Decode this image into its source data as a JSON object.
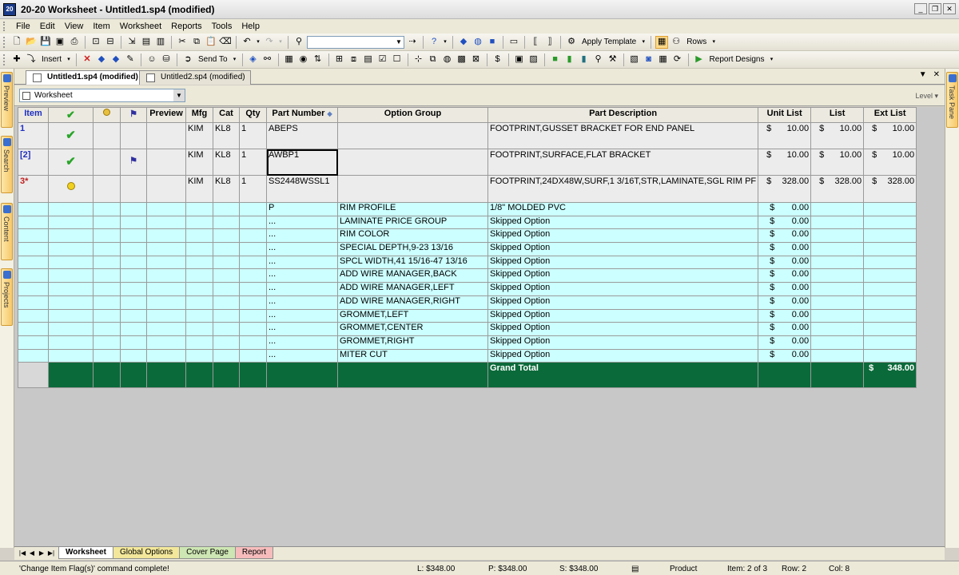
{
  "window": {
    "title": "20-20 Worksheet - Untitled1.sp4 (modified)",
    "icon_text": "20"
  },
  "menu": [
    "File",
    "Edit",
    "View",
    "Item",
    "Worksheet",
    "Reports",
    "Tools",
    "Help"
  ],
  "toolbar1": {
    "apply_template": "Apply Template",
    "rows": "Rows"
  },
  "toolbar2": {
    "insert": "Insert",
    "send_to": "Send To",
    "report_designs": "Report Designs"
  },
  "side_tabs_left": [
    "Preview",
    "Search",
    "Content",
    "Projects"
  ],
  "side_tabs_right": [
    "Task Pane"
  ],
  "doc_tabs": [
    {
      "label": "Untitled1.sp4 (modified)",
      "active": true
    },
    {
      "label": "Untitled2.sp4 (modified)",
      "active": false
    }
  ],
  "worksheet_selector": {
    "value": "Worksheet"
  },
  "level_label": "Level",
  "grid": {
    "headers": {
      "item": "Item",
      "preview": "Preview",
      "mfg": "Mfg",
      "cat": "Cat",
      "qty": "Qty",
      "part_number": "Part Number",
      "option_group": "Option Group",
      "part_description": "Part Description",
      "unit_list": "Unit List",
      "list": "List",
      "ext_list": "Ext List"
    },
    "currency": "$",
    "rows": [
      {
        "item": "1",
        "mfg": "KIM",
        "cat": "KL8",
        "qty": "1",
        "part_number": "ABEPS",
        "description": "FOOTPRINT,GUSSET BRACKET FOR END PANEL",
        "unit_list": "10.00",
        "list": "10.00",
        "ext_list": "10.00"
      },
      {
        "item": "[2]",
        "mfg": "KIM",
        "cat": "KL8",
        "qty": "1",
        "part_number": "AWBP1",
        "description": "FOOTPRINT,SURFACE,FLAT BRACKET",
        "unit_list": "10.00",
        "list": "10.00",
        "ext_list": "10.00"
      },
      {
        "item": "3*",
        "mfg": "KIM",
        "cat": "KL8",
        "qty": "1",
        "part_number": "SS2448WSSL1",
        "description": "FOOTPRINT,24DX48W,SURF,1 3/16T,STR,LAMINATE,SGL RIM PF",
        "unit_list": "328.00",
        "list": "328.00",
        "ext_list": "328.00"
      }
    ],
    "options": [
      {
        "code": "P",
        "group": "RIM PROFILE",
        "description": "1/8\" MOLDED PVC",
        "unit_list": "0.00"
      },
      {
        "code": "...",
        "group": "LAMINATE PRICE GROUP",
        "description": "Skipped Option",
        "unit_list": "0.00"
      },
      {
        "code": "...",
        "group": "RIM COLOR",
        "description": "Skipped Option",
        "unit_list": "0.00"
      },
      {
        "code": "...",
        "group": "SPECIAL DEPTH,9-23 13/16",
        "description": "Skipped Option",
        "unit_list": "0.00"
      },
      {
        "code": "...",
        "group": "SPCL WIDTH,41 15/16-47 13/16",
        "description": "Skipped Option",
        "unit_list": "0.00"
      },
      {
        "code": "...",
        "group": "ADD WIRE MANAGER,BACK",
        "description": "Skipped Option",
        "unit_list": "0.00"
      },
      {
        "code": "...",
        "group": "ADD WIRE MANAGER,LEFT",
        "description": "Skipped Option",
        "unit_list": "0.00"
      },
      {
        "code": "...",
        "group": "ADD WIRE MANAGER,RIGHT",
        "description": "Skipped Option",
        "unit_list": "0.00"
      },
      {
        "code": "...",
        "group": "GROMMET,LEFT",
        "description": "Skipped Option",
        "unit_list": "0.00"
      },
      {
        "code": "...",
        "group": "GROMMET,CENTER",
        "description": "Skipped Option",
        "unit_list": "0.00"
      },
      {
        "code": "...",
        "group": "GROMMET,RIGHT",
        "description": "Skipped Option",
        "unit_list": "0.00"
      },
      {
        "code": "...",
        "group": "MITER CUT",
        "description": "Skipped Option",
        "unit_list": "0.00"
      }
    ],
    "grand_total": {
      "label": "Grand Total",
      "value": "348.00"
    }
  },
  "sheet_tabs": [
    "Worksheet",
    "Global Options",
    "Cover Page",
    "Report"
  ],
  "status": {
    "message": "'Change Item Flag(s)' command complete!",
    "l": "L: $348.00",
    "p": "P: $348.00",
    "s": "S: $348.00",
    "mode": "Product",
    "item": "Item: 2 of 3",
    "row": "Row: 2",
    "col": "Col: 8"
  },
  "colors": {
    "option_row_bg": "#ccffff",
    "grand_total_bg": "#0a6a3a",
    "item_number": "#2030c0",
    "check_green": "#2aa52a"
  }
}
